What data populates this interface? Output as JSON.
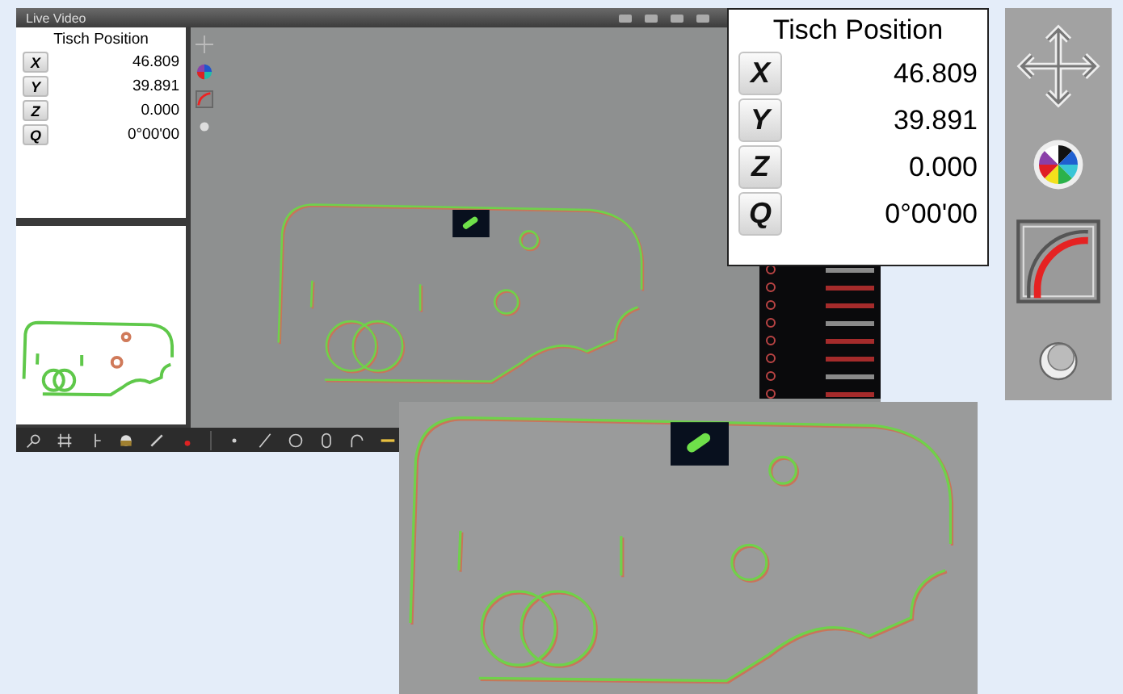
{
  "window": {
    "title": "Live Video"
  },
  "small_position_panel": {
    "title": "Tisch Position",
    "rows": [
      {
        "axis": "X",
        "value": "46.809"
      },
      {
        "axis": "Y",
        "value": "39.891"
      },
      {
        "axis": "Z",
        "value": "0.000"
      },
      {
        "axis": "Q",
        "value": "0°00'00"
      }
    ]
  },
  "large_position_panel": {
    "title": "Tisch Position",
    "rows": [
      {
        "axis": "X",
        "value": "46.809"
      },
      {
        "axis": "Y",
        "value": "39.891"
      },
      {
        "axis": "Z",
        "value": "0.000"
      },
      {
        "axis": "Q",
        "value": "0°00'00"
      }
    ]
  }
}
